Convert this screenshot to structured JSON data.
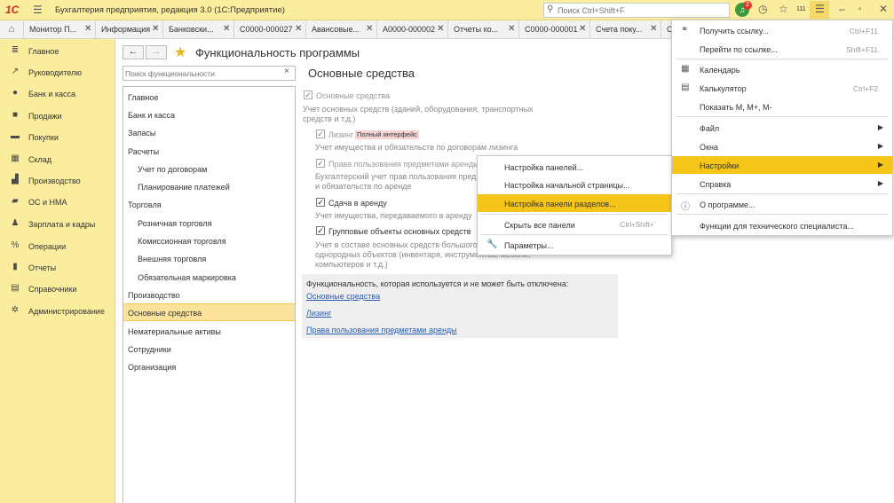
{
  "titlebar": {
    "logo": "1С",
    "title": "Бухгалтерия предприятия, редакция 3.0  (1С:Предприятие)",
    "search_placeholder": "Поиск Ctrl+Shift+F",
    "notifications_count": "2",
    "counter": "111"
  },
  "tabs": [
    {
      "label": "Монитор П..."
    },
    {
      "label": "Информация"
    },
    {
      "label": "Банковски..."
    },
    {
      "label": "С0000-000027"
    },
    {
      "label": "Авансовые..."
    },
    {
      "label": "А0000-000002"
    },
    {
      "label": "Отчеты ко..."
    },
    {
      "label": "С0000-000001"
    },
    {
      "label": "Счета поку..."
    },
    {
      "label": "С"
    }
  ],
  "sidebar": {
    "items": [
      {
        "label": "Главное",
        "icon": "list-icon"
      },
      {
        "label": "Руководителю",
        "icon": "trend-icon"
      },
      {
        "label": "Банк и касса",
        "icon": "coins-icon"
      },
      {
        "label": "Продажи",
        "icon": "bag-icon"
      },
      {
        "label": "Покупки",
        "icon": "cart-icon"
      },
      {
        "label": "Склад",
        "icon": "warehouse-icon"
      },
      {
        "label": "Производство",
        "icon": "factory-icon"
      },
      {
        "label": "ОС и НМА",
        "icon": "truck-icon"
      },
      {
        "label": "Зарплата и кадры",
        "icon": "person-icon"
      },
      {
        "label": "Операции",
        "icon": "operations-icon"
      },
      {
        "label": "Отчеты",
        "icon": "bar-chart-icon"
      },
      {
        "label": "Справочники",
        "icon": "book-icon"
      },
      {
        "label": "Администрирование",
        "icon": "gear-icon"
      }
    ]
  },
  "functionality": {
    "title": "Функциональность программы",
    "search_placeholder": "Поиск функциональности",
    "list": [
      {
        "label": "Главное",
        "indent": false
      },
      {
        "label": "Банк и касса",
        "indent": false
      },
      {
        "label": "Запасы",
        "indent": false
      },
      {
        "label": "Расчеты",
        "indent": false
      },
      {
        "label": "Учет по договорам",
        "indent": true
      },
      {
        "label": "Планирование платежей",
        "indent": true
      },
      {
        "label": "Торговля",
        "indent": false
      },
      {
        "label": "Розничная торговля",
        "indent": true
      },
      {
        "label": "Комиссионная торговля",
        "indent": true
      },
      {
        "label": "Внешняя торговля",
        "indent": true
      },
      {
        "label": "Обязательная маркировка",
        "indent": true
      },
      {
        "label": "Производство",
        "indent": false
      },
      {
        "label": "Основные средства",
        "indent": false,
        "selected": true
      },
      {
        "label": "Нематериальные активы",
        "indent": false
      },
      {
        "label": "Сотрудники",
        "indent": false
      },
      {
        "label": "Организация",
        "indent": false
      }
    ]
  },
  "content": {
    "title": "Основные средства",
    "os_label": "Основные средства",
    "os_desc_1": "Учет основных средств (зданий, оборудования, транспортных",
    "os_desc_2": "средств и т.д.)",
    "leasing_label": "Лизинг",
    "leasing_tag": "Полный интерфейс",
    "leasing_desc": "Учет имущества и обязательств  по договорам лизинга",
    "rights_label": "Права пользования предметами аренды",
    "rights_desc_1": "Бухгалтерский учет прав пользования пред",
    "rights_desc_2": "и обязательств по аренде",
    "rent_label": "Сдача в аренду",
    "rent_desc": "Учет имущества, передаваемого в аренду",
    "group_label": "Групповые объекты основных средств",
    "group_desc_1": "Учет в составе основных средств большого",
    "group_desc_2": "однородных объектов (инвентаря, инструментов, мебели,",
    "group_desc_3": "компьютеров и т.д.)",
    "info_text": "Функциональность, которая используется и не может быть отключена:",
    "info_links": [
      "Основные средства",
      "Лизинг",
      "Права пользования предметами аренды"
    ]
  },
  "submenu": {
    "items": [
      {
        "label": "Настройка панелей...",
        "shortcut": ""
      },
      {
        "label": "Настройка начальной страницы...",
        "shortcut": ""
      },
      {
        "label": "Настройка панели разделов...",
        "shortcut": ""
      },
      {
        "label": "Скрыть все панели",
        "shortcut": "Ctrl+Shift+'"
      },
      {
        "label": "Параметры...",
        "shortcut": ""
      }
    ]
  },
  "mainmenu": {
    "items": [
      {
        "label": "Получить ссылку...",
        "shortcut": "Ctrl+F11"
      },
      {
        "label": "Перейти по ссылке...",
        "shortcut": "Shift+F11"
      },
      {
        "label": "Календарь",
        "shortcut": ""
      },
      {
        "label": "Калькулятор",
        "shortcut": "Ctrl+F2"
      },
      {
        "label": "Показать М, М+, М-",
        "shortcut": ""
      },
      {
        "label": "Файл",
        "shortcut": ""
      },
      {
        "label": "Окна",
        "shortcut": ""
      },
      {
        "label": "Настройки",
        "shortcut": ""
      },
      {
        "label": "Справка",
        "shortcut": ""
      },
      {
        "label": "О программе...",
        "shortcut": ""
      },
      {
        "label": "Функции для технического специалиста...",
        "shortcut": ""
      }
    ]
  },
  "colors": {
    "accent": "#f6c519",
    "sidebar_bg": "#fbed9e",
    "link": "#2a5db0"
  }
}
